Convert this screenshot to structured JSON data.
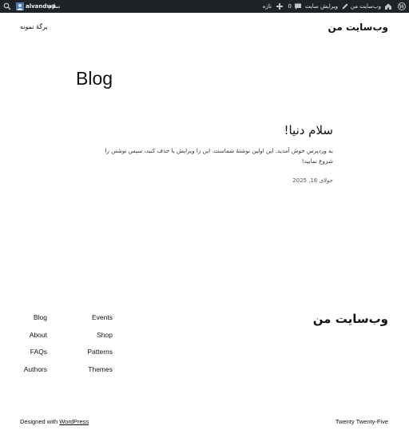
{
  "admin_bar": {
    "site_name": "وب‌سایت من",
    "customize": "ویرایش سایت",
    "comments_count": "0",
    "new_label": "تازه",
    "greeting": "سلام",
    "username": "alvandwp"
  },
  "header": {
    "site_title": "وب‌سایت من",
    "nav_sample_page": "برگهٔ نمونه"
  },
  "main": {
    "page_title": "Blog",
    "post": {
      "title": "سلام دنیا!",
      "excerpt": "به وردپرس خوش آمدید. این اولین نوشتهٔ شماست. این را ویرایش یا حذف کنید، سپس نوشتن را شروع نمایید!",
      "date": "جولای 16, 2025"
    }
  },
  "footer": {
    "site_title": "وب‌سایت من",
    "col1": [
      "Blog",
      "About",
      "FAQs",
      "Authors"
    ],
    "col2": [
      "Events",
      "Shop",
      "Patterns",
      "Themes"
    ],
    "credit_prefix": "Designed with ",
    "credit_link": "WordPress",
    "theme_name": "Twenty Twenty-Five"
  }
}
